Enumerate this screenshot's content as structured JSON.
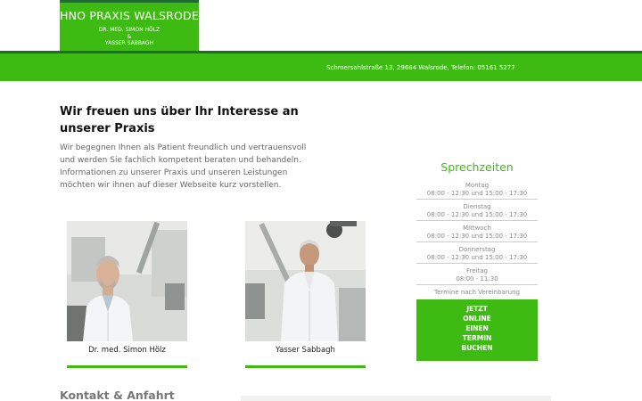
{
  "header": {
    "logo_title": "HNO PRAXIS WALSRODE",
    "logo_line1": "DR. MED. SIMON HÖLZ",
    "logo_line2": "&",
    "logo_line3": "YASSER SABBAGH",
    "address": "Schmersahlstraße 13, 29664 Walsrode, Telefon: 05161 5277"
  },
  "intro": {
    "title": "Wir freuen uns über Ihr Interesse an unserer Praxis",
    "text": "Wir begegnen Ihnen als Patient freundlich und vertrauensvoll und werden Sie fachlich kompetent beraten und behandeln. Informationen zu unserer Praxis und unseren Leistungen möchten wir ihnen auf dieser Webseite kurz vorstellen."
  },
  "doctors": [
    {
      "name": "Dr. med. Simon Hölz"
    },
    {
      "name": "Yasser Sabbagh"
    }
  ],
  "hours": {
    "title": "Sprechzeiten",
    "days": [
      {
        "day": "Montag",
        "time": "08:00 - 12:30 und 15:00 - 17:30"
      },
      {
        "day": "Dienstag",
        "time": "08:00 - 12:30 und 15:00 - 17:30"
      },
      {
        "day": "Mittwoch",
        "time": "08:00 - 12:30 und 15:00 - 17:30"
      },
      {
        "day": "Donnerstag",
        "time": "08:00 - 12:30 und 15:00 - 17:30"
      },
      {
        "day": "Freitag",
        "time": "08:00 - 11:30"
      }
    ],
    "note": "Termine nach Vereinbarung"
  },
  "booking": {
    "lines": [
      "JETZT",
      "ONLINE",
      "EINEN",
      "TERMIN",
      "BUCHEN"
    ]
  },
  "contact": {
    "title": "Kontakt & Anfahrt"
  },
  "colors": {
    "brand_green": "#3dbb12",
    "dark_green": "#1e6d2e"
  }
}
